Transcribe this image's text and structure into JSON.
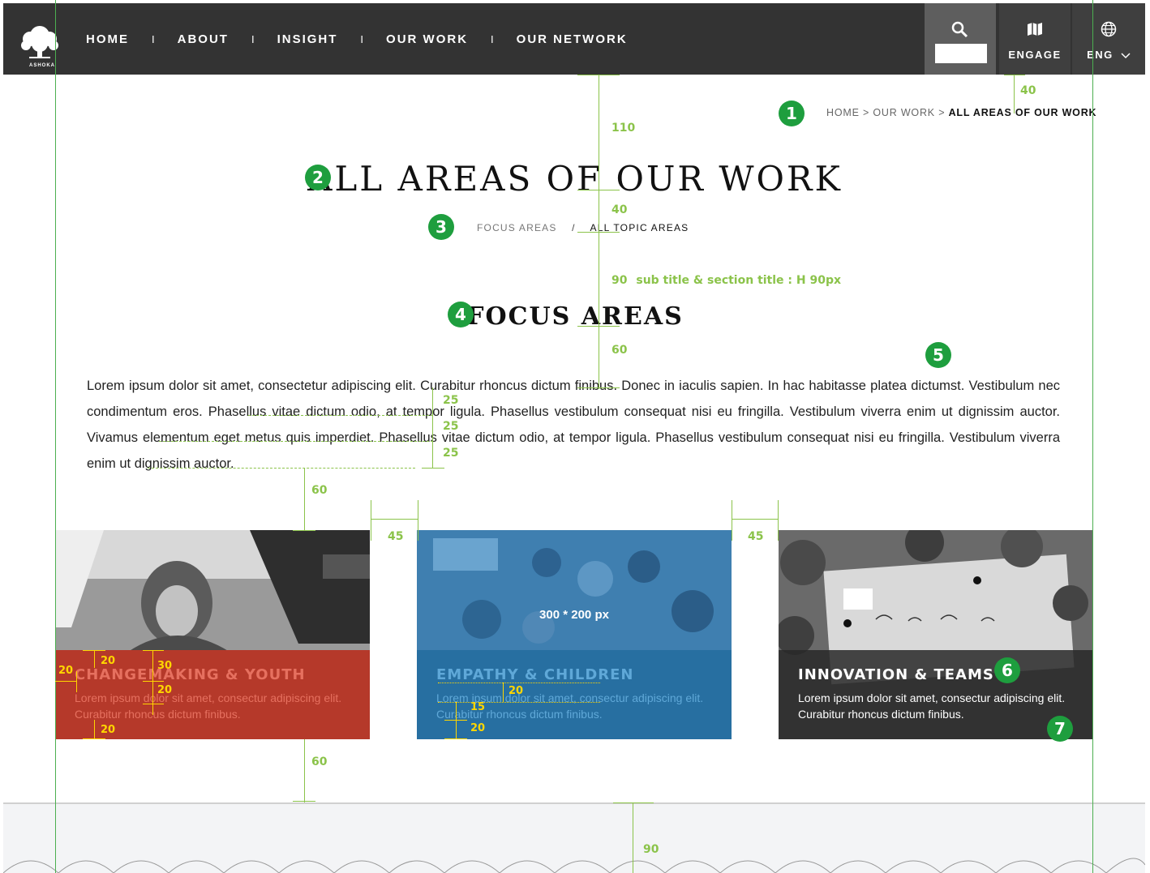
{
  "header": {
    "logo_text": "ASHOKA",
    "nav": [
      "HOME",
      "ABOUT",
      "INSIGHT",
      "OUR WORK",
      "OUR NETWORK"
    ],
    "nav_separator": "I",
    "search": {
      "icon": "search-icon",
      "placeholder": ""
    },
    "engage": {
      "icon": "map-icon",
      "label": "ENGAGE"
    },
    "language": {
      "icon": "globe-icon",
      "label": "ENG"
    }
  },
  "breadcrumb": {
    "items": [
      "HOME",
      "OUR WORK"
    ],
    "separator": ">",
    "current": "ALL AREAS OF OUR WORK"
  },
  "page_title": "ALL AREAS OF OUR WORK",
  "sub_nav": {
    "items": [
      "FOCUS AREAS",
      "ALL TOPIC AREAS"
    ],
    "separator": "/"
  },
  "section_title": "FOCUS AREAS",
  "body_text": "Lorem ipsum dolor sit amet, consectetur adipiscing elit. Curabitur rhoncus dictum finibus. Donec in iaculis sapien. In hac habitasse platea dictumst. Vestibulum nec condimentum eros. Phasellus vitae dictum odio, at tempor ligula. Phasellus vestibulum consequat nisi eu fringilla. Vestibulum viverra enim ut dignissim auctor. Vivamus elementum eget metus quis imperdiet. Phasellus vitae dictum odio, at tempor ligula. Phasellus vestibulum consequat nisi eu fringilla. Vestibulum viverra enim ut dignissim auctor.",
  "cards": [
    {
      "title": "CHANGEMAKING & YOUTH",
      "desc": "Lorem ipsum dolor sit amet, consectur adipiscing elit. Curabitur rhoncus  dictum finibus.",
      "color": "#b5392a"
    },
    {
      "title": "EMPATHY & CHILDREN",
      "desc": "Lorem ipsum dolor sit amet, consectur adipiscing elit. Curabitur rhoncus  dictum finibus.",
      "color": "#256ea0",
      "size_label": "300 * 200 px"
    },
    {
      "title": "INNOVATION & TEAMS",
      "desc": "Lorem ipsum dolor sit amet, consectur adipiscing elit. Curabitur rhoncus  dictum finibus.",
      "color": "#282828"
    }
  ],
  "markers": [
    "1",
    "2",
    "3",
    "4",
    "5",
    "6",
    "7"
  ],
  "annotations": {
    "d110": "110",
    "d40a": "40",
    "d40b": "40",
    "d90a": "90",
    "d90_note": "sub title & section title : H 90px",
    "d60a": "60",
    "d25a": "25",
    "d25b": "25",
    "d25c": "25",
    "d60b": "60",
    "d45a": "45",
    "d45b": "45",
    "d60c": "60",
    "d90b": "90",
    "y20a": "20",
    "y20b": "20",
    "y30": "30",
    "y20c": "20",
    "y20d": "20",
    "y20e": "20",
    "y15": "15",
    "y20f": "20"
  }
}
